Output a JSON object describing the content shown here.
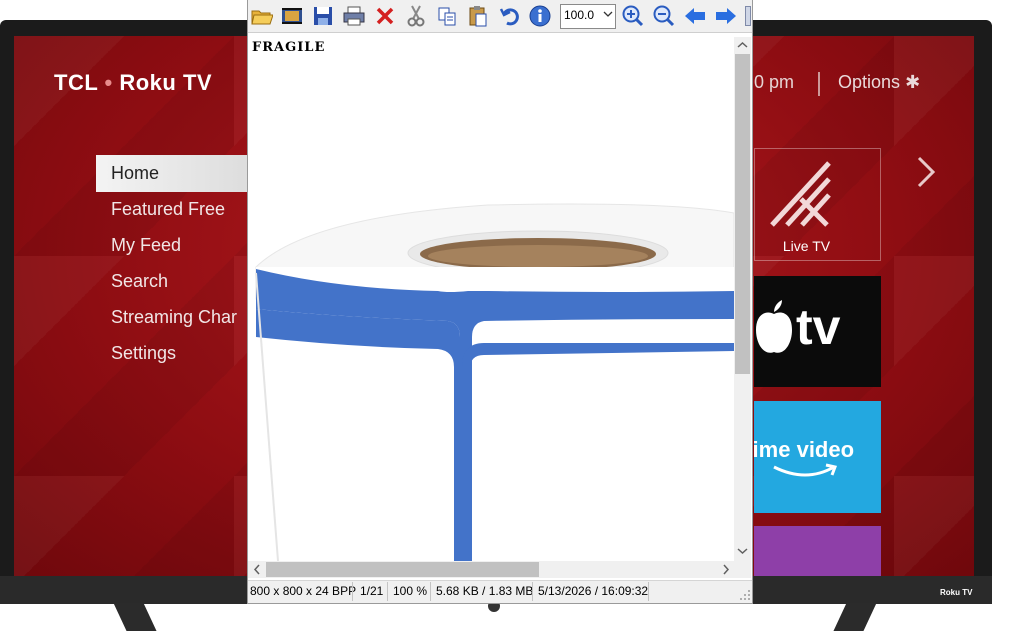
{
  "tv": {
    "brand": "TCL",
    "brand_sep": "•",
    "brand_model": "Roku TV",
    "menu": [
      "Home",
      "Featured Free",
      "My Feed",
      "Search",
      "Streaming Char",
      "Settings"
    ],
    "clock_fragment": "0 pm",
    "options_label": "Options",
    "options_glyph": "✱",
    "tiles": {
      "live_tv": "Live TV",
      "apple_tv": "tv",
      "prime": "rime video"
    },
    "badge": "Roku TV"
  },
  "viewer": {
    "zoom_value": "100.0",
    "image_text": "FRAGILE",
    "colors": {
      "label_blue": "#4373c9",
      "core": "#8b6a4a",
      "roll_white": "#f7f7f7"
    },
    "status": {
      "dimensions": "800 x 800 x 24 BPP",
      "index": "1/21",
      "zoom": "100 %",
      "size": "5.68 KB / 1.83 MB",
      "datetime": "5/13/2026 / 16:09:32"
    },
    "toolbar_icons": [
      "open-folder-icon",
      "filmstrip-icon",
      "save-icon",
      "print-icon",
      "delete-icon",
      "cut-icon",
      "copy-icon",
      "paste-icon",
      "undo-icon",
      "info-icon",
      "zoom-in-icon",
      "zoom-out-icon",
      "previous-arrow-icon",
      "next-arrow-icon"
    ]
  }
}
